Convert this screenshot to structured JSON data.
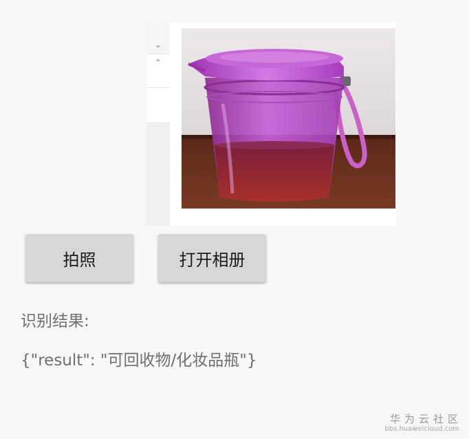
{
  "preview": {
    "scroll_down_icon": "chevron-down-icon",
    "scroll_up_icon": "chevron-up-icon",
    "image_subject": "purple-cup-with-liquid"
  },
  "actions": {
    "take_photo_label": "拍照",
    "open_album_label": "打开相册"
  },
  "result": {
    "label": "识别结果:",
    "value": "{\"result\": \"可回收物/化妆品瓶\"}"
  },
  "watermark": {
    "title": "华为云社区",
    "url": "bbs.huaweicloud.com"
  },
  "colors": {
    "background": "#f7f7f7",
    "button": "#d6d7d7",
    "result_text": "#6f6f6f",
    "cup_purple": "#b43fd0"
  }
}
